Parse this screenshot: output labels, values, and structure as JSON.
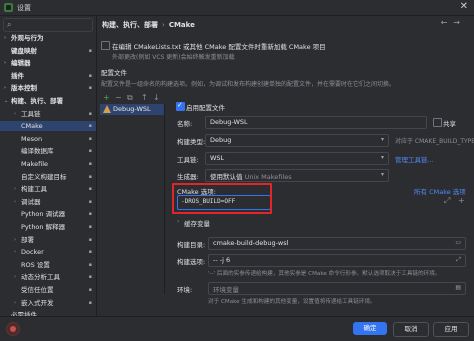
{
  "window": {
    "title": "设置",
    "icon": "app-icon",
    "close": "✕"
  },
  "sidebar": {
    "search_icon": "search-icon",
    "items": [
      {
        "label": "外观与行为",
        "bold": true,
        "arrow": "›"
      },
      {
        "label": "键盘映射",
        "bold": true
      },
      {
        "label": "编辑器",
        "bold": true,
        "arrow": "›"
      },
      {
        "label": "插件",
        "bold": true
      },
      {
        "label": "版本控制",
        "bold": true,
        "arrow": "›"
      },
      {
        "label": "构建、执行、部署",
        "bold": true,
        "arrow": "⌄"
      },
      {
        "label": "工具链",
        "arrow": "›"
      },
      {
        "label": "CMake",
        "selected": true
      },
      {
        "label": "Meson"
      },
      {
        "label": "编译数据库"
      },
      {
        "label": "Makefile"
      },
      {
        "label": "自定义构建目标"
      },
      {
        "label": "构建工具",
        "arrow": "›"
      },
      {
        "label": "调试器",
        "arrow": "›"
      },
      {
        "label": "Python 调试器"
      },
      {
        "label": "Python 解释器"
      },
      {
        "label": "部署",
        "arrow": "›"
      },
      {
        "label": "Docker",
        "arrow": "›"
      },
      {
        "label": "ROS 设置"
      },
      {
        "label": "动态分析工具",
        "arrow": "›"
      },
      {
        "label": "受信任位置"
      },
      {
        "label": "嵌入式开发",
        "arrow": "›"
      },
      {
        "label": "必需插件"
      }
    ]
  },
  "breadcrumb": {
    "parent": "构建、执行、部署",
    "sep": "›",
    "current": "CMake",
    "back": "←",
    "forward": "→"
  },
  "reload": {
    "label": "在编辑 CMakeLists.txt 或其他 CMake 配置文件时重新加载 CMake 项目",
    "hint": "外部更改(例如 VCS 更新)会始终触发重新加载"
  },
  "profiles": {
    "heading": "配置文件",
    "description": "配置文件是一组命名的构建选项。例如，为调试和发布构建创建单独的配置文件，并在需要时在它们之间切换。",
    "toolbar": [
      "+",
      "−",
      "⧉",
      "↑",
      "↓"
    ],
    "items": [
      "Debug-WSL"
    ]
  },
  "form": {
    "enable_label": "启用配置文件",
    "name_label": "名称:",
    "name_value": "Debug-WSL",
    "shared_label": "共享",
    "build_type_label": "构建类型:",
    "build_type_value": "Debug",
    "build_type_hint": "对应于 CMAKE_BUILD_TYPE",
    "toolchain_label": "工具链:",
    "toolchain_value": "WSL",
    "toolchain_link": "管理工具链...",
    "generator_label": "生成器:",
    "generator_value": "使用默认值",
    "generator_hint": "Unix Makefiles",
    "cmake_options_label": "CMake 选项:",
    "cmake_options_value": "-DROS_BUILD=OFF",
    "cmake_all_options_link": "所有 CMake 选项",
    "cache_label": "缓存变量",
    "build_dir_label": "构建目录:",
    "build_dir_value": "cmake-build-debug-wsl",
    "build_opts_label": "构建选项:",
    "build_opts_value": "-- -j 6",
    "build_opts_hint": "'--' 后面的实参传递给构建，其他实参是 CMake 命令行形参。默认选项取决于工具链的环境。",
    "env_label": "环境:",
    "env_placeholder": "环境变量",
    "env_hint": "对于 CMake 生成和构建的其他变量，设置值将传递给工具链环境。"
  },
  "footer": {
    "ok": "确定",
    "cancel": "取消",
    "apply": "应用"
  },
  "colors": {
    "accent": "#3574f0",
    "highlight": "#e0262a",
    "selection": "#2e436e"
  }
}
